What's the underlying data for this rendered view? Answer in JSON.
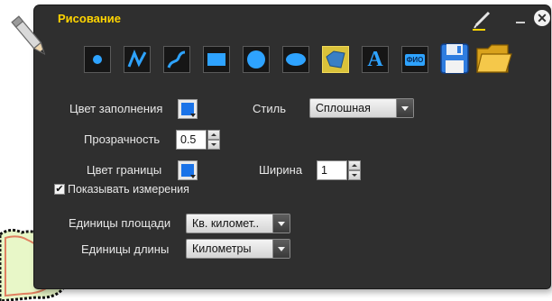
{
  "window": {
    "title": "Рисование",
    "close_glyph": "✕",
    "icons": [
      "pencil-icon",
      "minimize-icon",
      "close-icon"
    ]
  },
  "toolbar": {
    "tools": [
      {
        "name": "point-tool",
        "icon": "dot-icon"
      },
      {
        "name": "polyline-tool",
        "icon": "polyline-icon"
      },
      {
        "name": "freehand-tool",
        "icon": "curve-icon"
      },
      {
        "name": "rectangle-tool",
        "icon": "rectangle-icon"
      },
      {
        "name": "circle-tool",
        "icon": "circle-icon"
      },
      {
        "name": "ellipse-tool",
        "icon": "ellipse-icon"
      },
      {
        "name": "polygon-tool",
        "icon": "polygon-icon",
        "active": true
      },
      {
        "name": "text-tool",
        "icon": "text-icon",
        "glyph": "A"
      },
      {
        "name": "label-tool",
        "icon": "label-icon",
        "glyph": "ФИО"
      },
      {
        "name": "save-tool",
        "icon": "floppy-disk-icon"
      },
      {
        "name": "open-tool",
        "icon": "folder-icon"
      }
    ]
  },
  "fill": {
    "label": "Цвет заполнения",
    "color": "#1a73e8"
  },
  "style": {
    "label": "Стиль",
    "value": "Сплошная"
  },
  "opacity": {
    "label": "Прозрачность",
    "value": "0.5"
  },
  "border": {
    "label": "Цвет границы",
    "color": "#1a73e8"
  },
  "width": {
    "label": "Ширина",
    "value": "1"
  },
  "measurements": {
    "label": "Показывать измерения",
    "checked": true,
    "check_glyph": "✔"
  },
  "area_units": {
    "label": "Единицы площади",
    "value": "Кв. километ.."
  },
  "length_units": {
    "label": "Единицы длины",
    "value": "Километры"
  },
  "colors": {
    "panel": "#2f2f2f",
    "title": "#ffd400",
    "active_tool": "#dac23a"
  }
}
